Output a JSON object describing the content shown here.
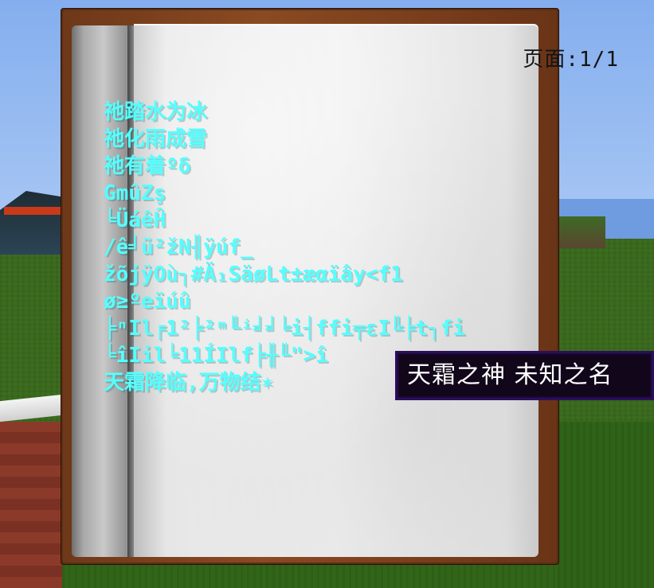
{
  "book": {
    "page_label": "页面:1/1",
    "lines": [
      "祂踏水为冰",
      "祂化雨成雪",
      "祂有着ºδ",
      "GmûZş",
      "╘ÜáêĤ",
      "/ê╛ũ²žN╢ÿúf_",
      "žõjÿOù┐#Ä₁SäøLt±æαïây<f1",
      "ø≥ºeïúû",
      "╞ⁿIl╒1²╞²ᵐ╙ⁱ╛╛╘i┤ffi╤εI╚╞t┐fi",
      "╘îIil╘11ÍIlf╞╫╙\">î",
      "天霜降临,万物结✶"
    ]
  },
  "tooltip": {
    "text": "天霜之神 未知之名"
  },
  "colors": {
    "text_cyan": "#55ffff",
    "tooltip_bg": "#11061a",
    "tooltip_border": "#2b0e5c"
  }
}
